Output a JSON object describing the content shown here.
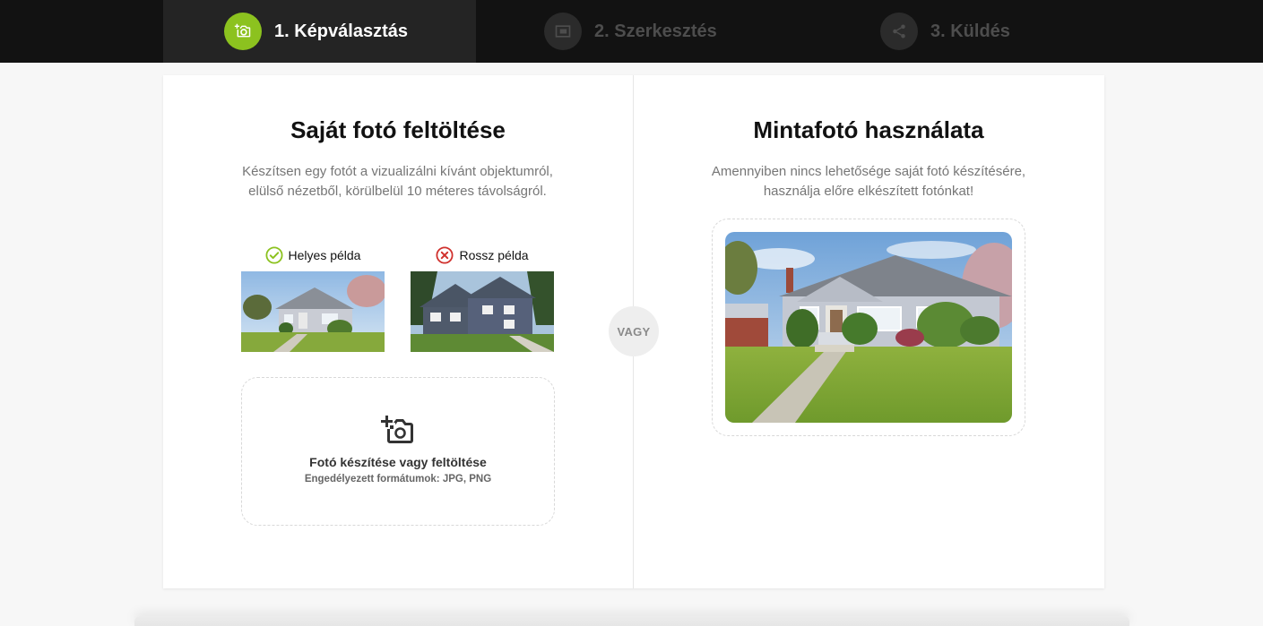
{
  "steps": [
    {
      "label": "1. Képválasztás",
      "icon": "add-photo-icon",
      "active": true
    },
    {
      "label": "2. Szerkesztés",
      "icon": "crop-icon",
      "active": false
    },
    {
      "label": "3. Küldés",
      "icon": "share-icon",
      "active": false
    }
  ],
  "colors": {
    "accent": "#8cc21f",
    "good": "#8cc21f",
    "bad": "#d0312d"
  },
  "left": {
    "title": "Saját fotó feltöltése",
    "description": "Készítsen egy fotót a vizualizálni kívánt objektumról, elülső nézetből, körülbelül 10 méteres távolságról.",
    "good_example": {
      "label": "Helyes példa",
      "icon": "check-circle-icon"
    },
    "bad_example": {
      "label": "Rossz példa",
      "icon": "x-circle-icon"
    },
    "upload": {
      "title": "Fotó készítése vagy feltöltése",
      "formats": "Engedélyezett formátumok: JPG, PNG"
    }
  },
  "separator": "VAGY",
  "right": {
    "title": "Mintafotó használata",
    "description": "Amennyiben nincs lehetősége saját fotó készítésére, használja előre elkészített fotónkat!"
  }
}
